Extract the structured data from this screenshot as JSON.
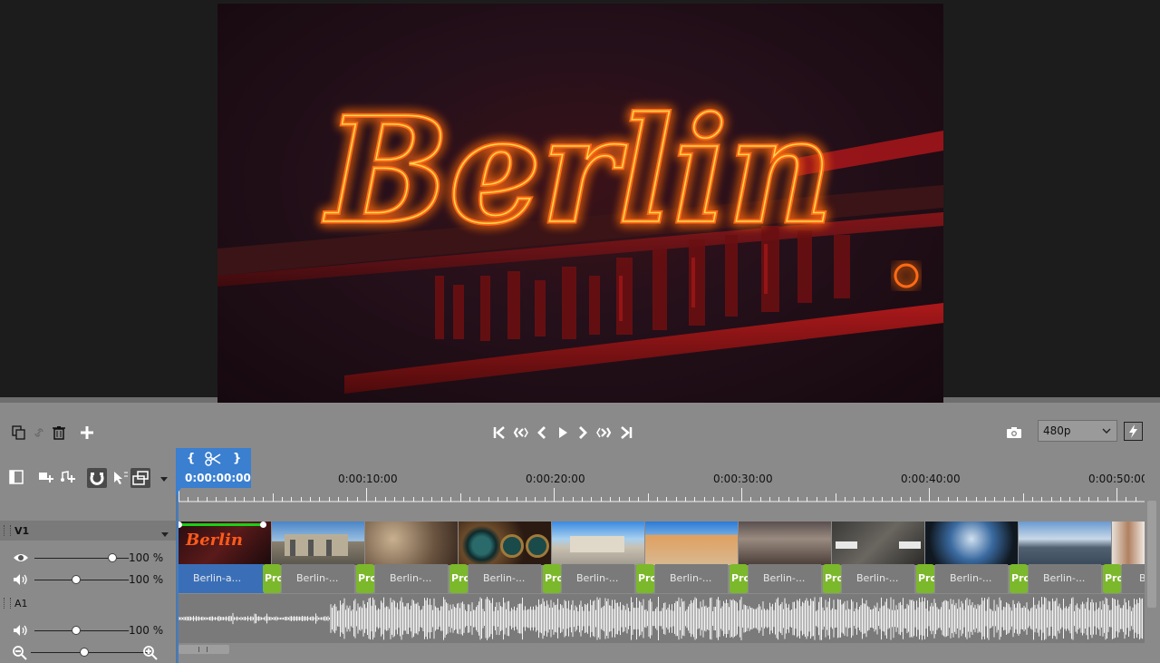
{
  "preview": {
    "neon_text": "Berlin"
  },
  "toolbar": {
    "resolution": "480p",
    "icons": [
      "copy-icon",
      "link-icon",
      "trash-icon",
      "add-icon",
      "go-to-start-icon",
      "previous-keyframe-icon",
      "step-back-icon",
      "play-icon",
      "step-forward-icon",
      "next-keyframe-icon",
      "go-to-end-icon",
      "camera-icon",
      "fast-preview-icon"
    ]
  },
  "playhead": {
    "time": "0:00:00:00",
    "open_brace": "{",
    "close_brace": "}"
  },
  "ruler": {
    "labels": [
      "0:00:10:00",
      "0:00:20:00",
      "0:00:30:00",
      "0:00:40:00",
      "0:00:50:00"
    ]
  },
  "tracks": {
    "video": {
      "name": "V1",
      "opacity": "100 %",
      "volume": "100 %"
    },
    "audio": {
      "name": "A1",
      "volume": "100 %"
    }
  },
  "clips": [
    {
      "label": "Berlin-a...",
      "selected": true
    },
    {
      "label": "Berlin-..."
    },
    {
      "label": "Berlin-..."
    },
    {
      "label": "Berlin-..."
    },
    {
      "label": "Berlin-..."
    },
    {
      "label": "Berlin-..."
    },
    {
      "label": "Berlin-..."
    },
    {
      "label": "Berlin-..."
    },
    {
      "label": "Berlin-..."
    },
    {
      "label": "Berlin-..."
    },
    {
      "label": "B"
    }
  ],
  "pro_tag": "Pro",
  "colors": {
    "accent": "#3a7fd0",
    "pro": "#7cb82b",
    "neon": "#ff7a1a"
  }
}
